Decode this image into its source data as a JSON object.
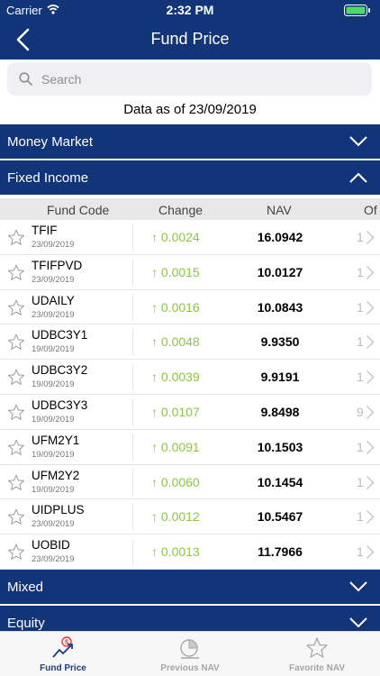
{
  "status_bar": {
    "carrier": "Carrier",
    "time": "2:32 PM"
  },
  "header": {
    "title": "Fund Price"
  },
  "search": {
    "placeholder": "Search"
  },
  "as_of": "Data as of 23/09/2019",
  "sections": {
    "money_market": "Money Market",
    "fixed_income": "Fixed Income",
    "mixed": "Mixed",
    "equity": "Equity"
  },
  "columns": {
    "code": "Fund Code",
    "change": "Change",
    "nav": "NAV",
    "extra": "Of"
  },
  "funds": [
    {
      "code": "TFIF",
      "date": "23/09/2019",
      "change": "0.0024",
      "nav": "16.0942",
      "extra": "1"
    },
    {
      "code": "TFIFPVD",
      "date": "23/09/2019",
      "change": "0.0015",
      "nav": "10.0127",
      "extra": "1"
    },
    {
      "code": "UDAILY",
      "date": "23/09/2019",
      "change": "0.0016",
      "nav": "10.0843",
      "extra": "1"
    },
    {
      "code": "UDBC3Y1",
      "date": "19/09/2019",
      "change": "0.0048",
      "nav": "9.9350",
      "extra": "1"
    },
    {
      "code": "UDBC3Y2",
      "date": "19/09/2019",
      "change": "0.0039",
      "nav": "9.9191",
      "extra": "1"
    },
    {
      "code": "UDBC3Y3",
      "date": "19/09/2019",
      "change": "0.0107",
      "nav": "9.8498",
      "extra": "9"
    },
    {
      "code": "UFM2Y1",
      "date": "19/09/2019",
      "change": "0.0091",
      "nav": "10.1503",
      "extra": "1"
    },
    {
      "code": "UFM2Y2",
      "date": "19/09/2019",
      "change": "0.0060",
      "nav": "10.1454",
      "extra": "1"
    },
    {
      "code": "UIDPLUS",
      "date": "23/09/2019",
      "change": "0.0012",
      "nav": "10.5467",
      "extra": "1"
    },
    {
      "code": "UOBID",
      "date": "23/09/2019",
      "change": "0.0013",
      "nav": "11.7966",
      "extra": "1"
    }
  ],
  "tabs": [
    {
      "label": "Fund Price",
      "icon": "fund-price-icon",
      "active": true
    },
    {
      "label": "Previous NAV",
      "icon": "pie-chart-icon",
      "active": false
    },
    {
      "label": "Favorite NAV",
      "icon": "star-icon",
      "active": false
    }
  ],
  "colors": {
    "brand": "#12357a",
    "up": "#8cc63f",
    "tab_active": "#1a3c8c",
    "tab_inactive": "#a6a6a6"
  }
}
